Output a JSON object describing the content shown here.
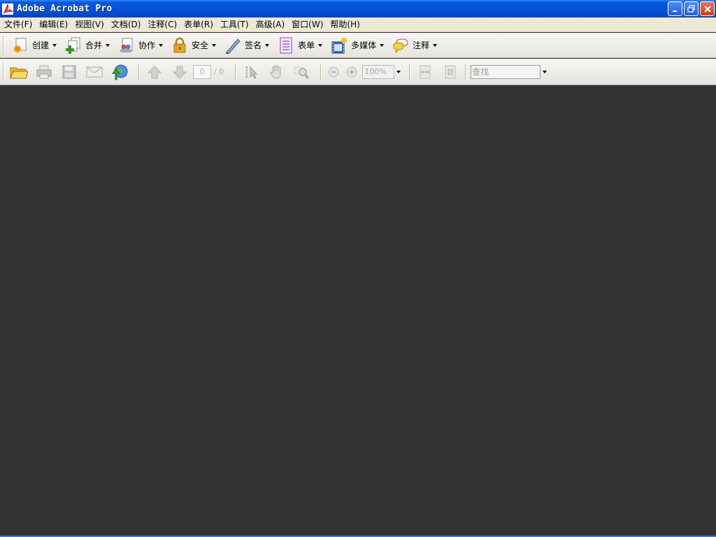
{
  "window": {
    "title": "Adobe Acrobat Pro"
  },
  "menubar": {
    "items": [
      {
        "label": "文件(F)"
      },
      {
        "label": "编辑(E)"
      },
      {
        "label": "视图(V)"
      },
      {
        "label": "文档(D)"
      },
      {
        "label": "注释(C)"
      },
      {
        "label": "表单(R)"
      },
      {
        "label": "工具(T)"
      },
      {
        "label": "高级(A)"
      },
      {
        "label": "窗口(W)"
      },
      {
        "label": "帮助(H)"
      }
    ]
  },
  "tasks_toolbar": {
    "buttons": [
      {
        "label": "创建",
        "icon": "create-pdf-icon"
      },
      {
        "label": "合并",
        "icon": "combine-icon"
      },
      {
        "label": "协作",
        "icon": "collaborate-icon"
      },
      {
        "label": "安全",
        "icon": "lock-icon"
      },
      {
        "label": "签名",
        "icon": "pen-icon"
      },
      {
        "label": "表单",
        "icon": "form-icon"
      },
      {
        "label": "多媒体",
        "icon": "multimedia-icon"
      },
      {
        "label": "注释",
        "icon": "comment-icon"
      }
    ]
  },
  "file_toolbar": {
    "page_current": "0",
    "page_total": "/ 0",
    "zoom": "100%",
    "search_placeholder": "查找"
  },
  "colors": {
    "workspace": "#333333",
    "titlebar": "#0553d8",
    "menubar": "#ece9d8"
  }
}
